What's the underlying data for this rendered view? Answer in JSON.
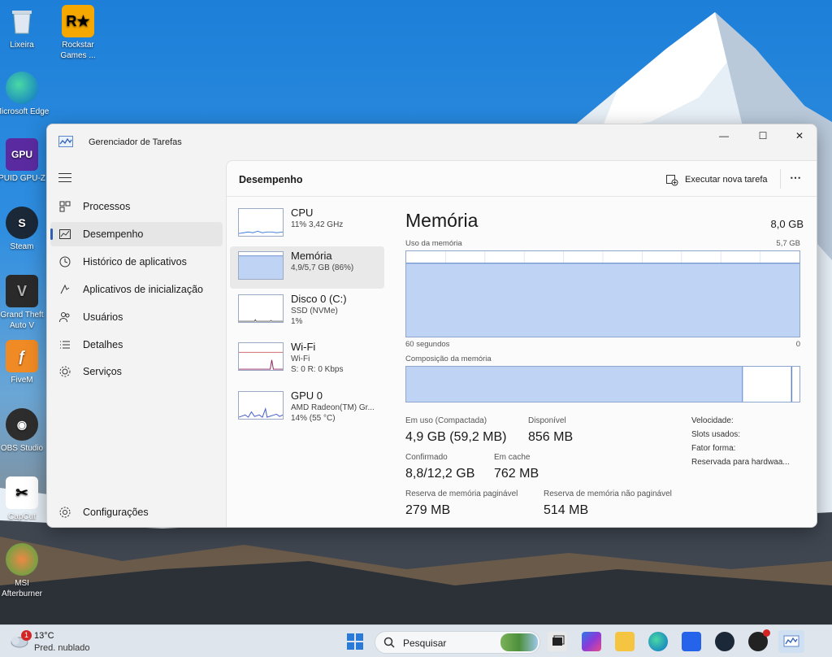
{
  "desktop": {
    "icons": [
      {
        "label": "Lixeira"
      },
      {
        "label": "Rockstar Games ..."
      },
      {
        "label": "Microsoft Edge"
      },
      {
        "label": "PUID GPU-Z"
      },
      {
        "label": "Steam"
      },
      {
        "label": "Grand Theft Auto V"
      },
      {
        "label": "FiveM"
      },
      {
        "label": "OBS Studio"
      },
      {
        "label": "CapCut"
      },
      {
        "label": "MSI Afterburner"
      }
    ]
  },
  "window": {
    "title": "Gerenciador de Tarefas",
    "controls": {
      "minimize": "—",
      "maximize": "☐",
      "close": "✕"
    }
  },
  "sidebar": {
    "items": [
      {
        "label": "Processos"
      },
      {
        "label": "Desempenho"
      },
      {
        "label": "Histórico de aplicativos"
      },
      {
        "label": "Aplicativos de inicialização"
      },
      {
        "label": "Usuários"
      },
      {
        "label": "Detalhes"
      },
      {
        "label": "Serviços"
      }
    ],
    "settings_label": "Configurações"
  },
  "main": {
    "header_title": "Desempenho",
    "run_task_label": "Executar nova tarefa",
    "more_label": "⋯"
  },
  "perf_items": [
    {
      "name": "CPU",
      "sub1": "11% 3,42 GHz",
      "sub2": ""
    },
    {
      "name": "Memória",
      "sub1": "4,9/5,7 GB (86%)",
      "sub2": ""
    },
    {
      "name": "Disco 0 (C:)",
      "sub1": "SSD (NVMe)",
      "sub2": "1%"
    },
    {
      "name": "Wi-Fi",
      "sub1": "Wi-Fi",
      "sub2": "S: 0 R: 0 Kbps"
    },
    {
      "name": "GPU 0",
      "sub1": "AMD Radeon(TM) Gr...",
      "sub2": "14% (55 °C)"
    }
  ],
  "memory": {
    "title": "Memória",
    "total": "8,0 GB",
    "usage_label": "Uso da memória",
    "usage_max": "5,7 GB",
    "axis_left": "60 segundos",
    "axis_right": "0",
    "composition_label": "Composição da memória",
    "usage_fraction": 0.86,
    "composition": {
      "in_use_fraction": 0.855,
      "standby_fraction": 0.125
    },
    "stats": {
      "in_use_label": "Em uso (Compactada)",
      "in_use_value": "4,9 GB (59,2 MB)",
      "available_label": "Disponível",
      "available_value": "856 MB",
      "committed_label": "Confirmado",
      "committed_value": "8,8/12,2 GB",
      "cached_label": "Em cache",
      "cached_value": "762 MB",
      "paged_label": "Reserva de memória paginável",
      "paged_value": "279 MB",
      "nonpaged_label": "Reserva de memória não paginável",
      "nonpaged_value": "514 MB"
    },
    "right": {
      "speed": "Velocidade:",
      "slots": "Slots usados:",
      "form": "Fator forma:",
      "reserved": "Reservada para hardwaa..."
    }
  },
  "taskbar": {
    "weather_temp": "13°C",
    "weather_desc": "Pred. nublado",
    "weather_badge": "1",
    "search_placeholder": "Pesquisar"
  },
  "colors": {
    "accent": "#2f5fb3",
    "graph_fill": "#bfd3f5",
    "graph_line": "#5f86c9"
  }
}
